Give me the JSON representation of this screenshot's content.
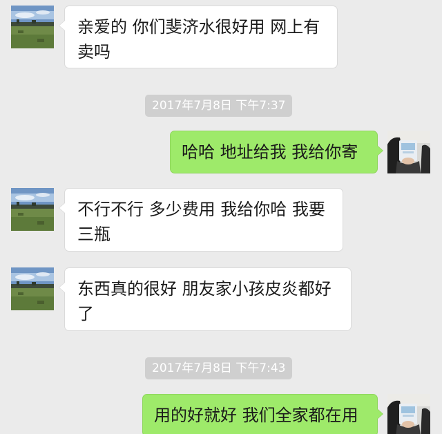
{
  "conversation": {
    "messages": [
      {
        "direction": "in",
        "text": "亲爱的 你们斐济水很好用 网上有卖吗"
      },
      {
        "direction": "out",
        "text": "哈哈 地址给我 我给你寄"
      },
      {
        "direction": "in",
        "text": "不行不行 多少费用 我给你哈 我要三瓶"
      },
      {
        "direction": "in",
        "text": "东西真的很好 朋友家小孩皮炎都好了"
      },
      {
        "direction": "out",
        "text": "用的好就好 我们全家都在用"
      }
    ],
    "timestamps": [
      "2017年7月8日 下午7:37",
      "2017年7月8日 下午7:43"
    ]
  },
  "colors": {
    "background": "#ebebeb",
    "incoming_bubble": "#ffffff",
    "outgoing_bubble": "#9eea6a",
    "timestamp_badge": "#cfcfcf"
  },
  "icons": {
    "contact_avatar": "landscape-avatar-icon",
    "self_avatar": "person-photo-avatar-icon"
  }
}
